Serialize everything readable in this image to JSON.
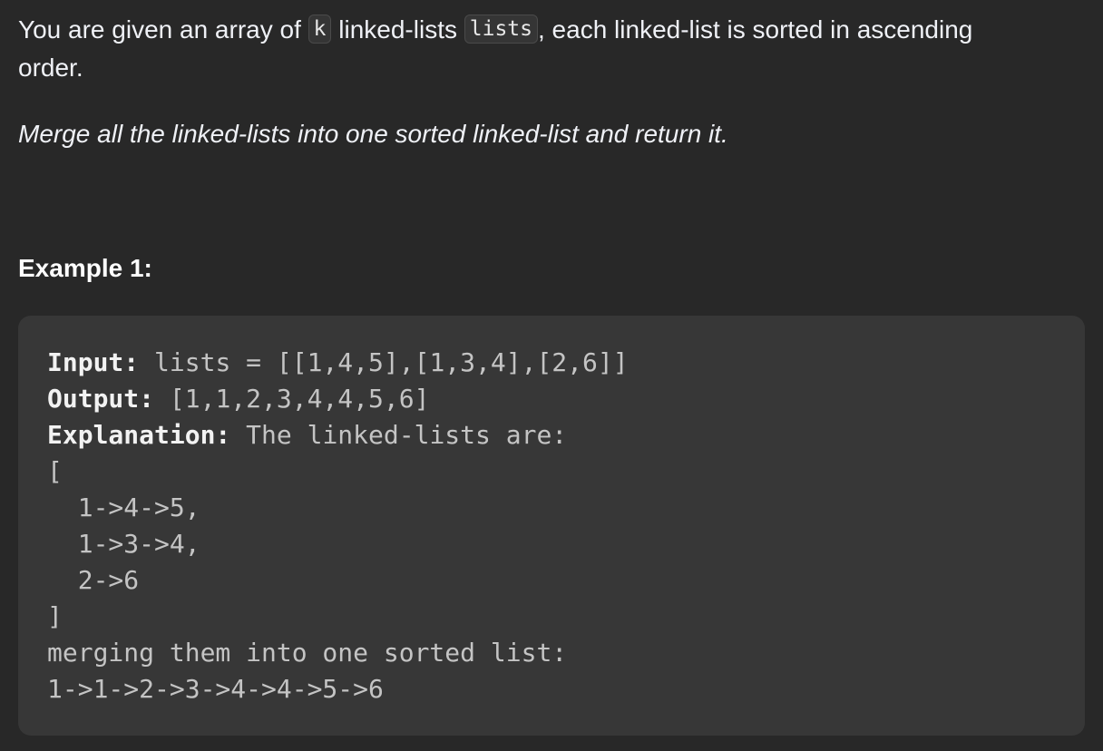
{
  "description": {
    "part1": "You are given an array of ",
    "code_k": "k",
    "part2": " linked-lists ",
    "code_lists": "lists",
    "part3": ", each linked-list is sorted in ascending",
    "part4": "order."
  },
  "task": "Merge all the linked-lists into one sorted linked-list and return it.",
  "example": {
    "title": "Example 1:",
    "input_label": "Input:",
    "input_value": " lists = [[1,4,5],[1,3,4],[2,6]]",
    "output_label": "Output:",
    "output_value": " [1,1,2,3,4,4,5,6]",
    "explanation_label": "Explanation:",
    "explanation_value": " The linked-lists are:",
    "lines": [
      "[",
      "  1->4->5,",
      "  1->3->4,",
      "  2->6",
      "]",
      "merging them into one sorted list:",
      "1->1->2->3->4->4->5->6"
    ]
  }
}
